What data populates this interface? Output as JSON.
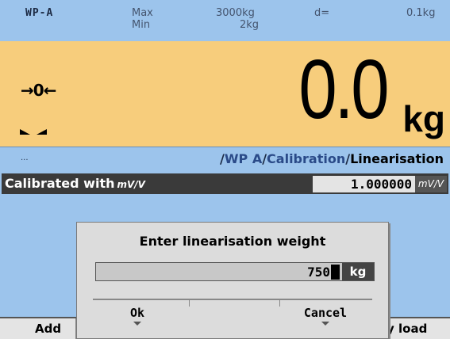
{
  "header": {
    "wp_label": "WP-A",
    "max_label": "Max",
    "max_value": "3000kg",
    "min_label": "Min",
    "min_value": "2kg",
    "d_label": "d=",
    "d_value": "0.1kg"
  },
  "weight": {
    "zero_indicator": "→0←",
    "value": "0.0",
    "unit": "kg"
  },
  "breadcrumb": {
    "dots": "...",
    "sep1": "/",
    "part1": "WP A",
    "sep2": "/",
    "part2": "Calibration",
    "sep3": "/",
    "current": "Linearisation"
  },
  "calibration_row": {
    "label": "Calibrated with",
    "label_unit": "mV/V",
    "value": "1.000000",
    "value_unit": "mV/V"
  },
  "softkeys": {
    "left_label": "Add",
    "right_label": "y load"
  },
  "dialog": {
    "title": "Enter linearisation weight",
    "input_value": "750",
    "input_unit": "kg",
    "ok_label": "Ok",
    "cancel_label": "Cancel"
  },
  "colors": {
    "background": "#9cc4ec",
    "weight_panel": "#f7cd7c",
    "dark_row": "#3a3a3a",
    "dialog": "#dcdcdc"
  },
  "icons": [
    "zero-center-icon",
    "stable-left-icon",
    "stable-right-icon",
    "ok-arrow-icon",
    "cancel-arrow-icon"
  ]
}
